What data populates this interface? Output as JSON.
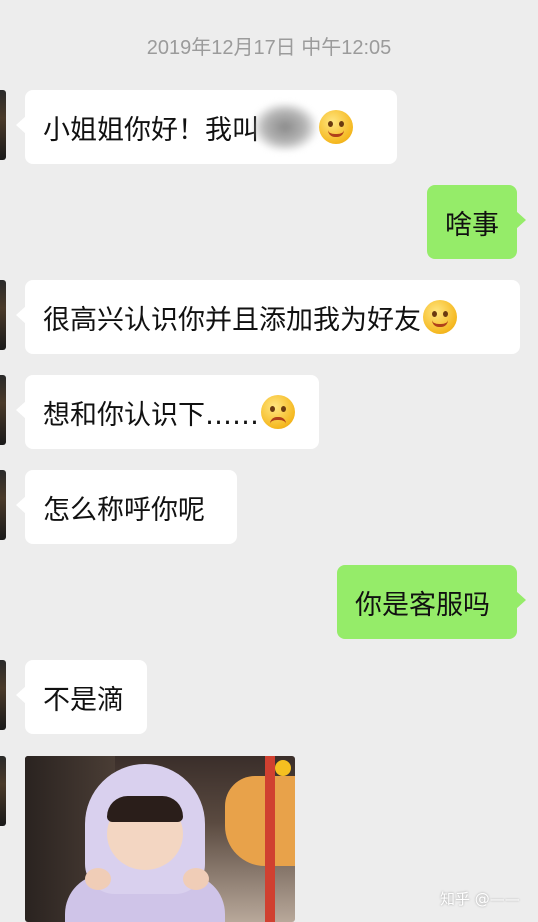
{
  "chat": {
    "timestamp": "2019年12月17日 中午12:05",
    "messages": [
      {
        "side": "left",
        "text": "小姐姐你好！我叫",
        "emoji": "wink-tongue-emoji"
      },
      {
        "side": "right",
        "text": "啥事"
      },
      {
        "side": "left",
        "text": "很高兴认识你并且添加我为好友",
        "emoji": "smile-emoji"
      },
      {
        "side": "left",
        "text": "想和你认识下……",
        "emoji": "sad-emoji"
      },
      {
        "side": "left",
        "text": "怎么称呼你呢"
      },
      {
        "side": "right",
        "text": "你是客服吗"
      },
      {
        "side": "left",
        "text": "不是滴"
      },
      {
        "side": "left",
        "type": "image",
        "image": "child-photo"
      }
    ]
  },
  "watermark": "知乎 @——",
  "colors": {
    "background": "#ededed",
    "left_bubble": "#ffffff",
    "right_bubble": "#95ec69",
    "timestamp": "#9b9b9b"
  }
}
